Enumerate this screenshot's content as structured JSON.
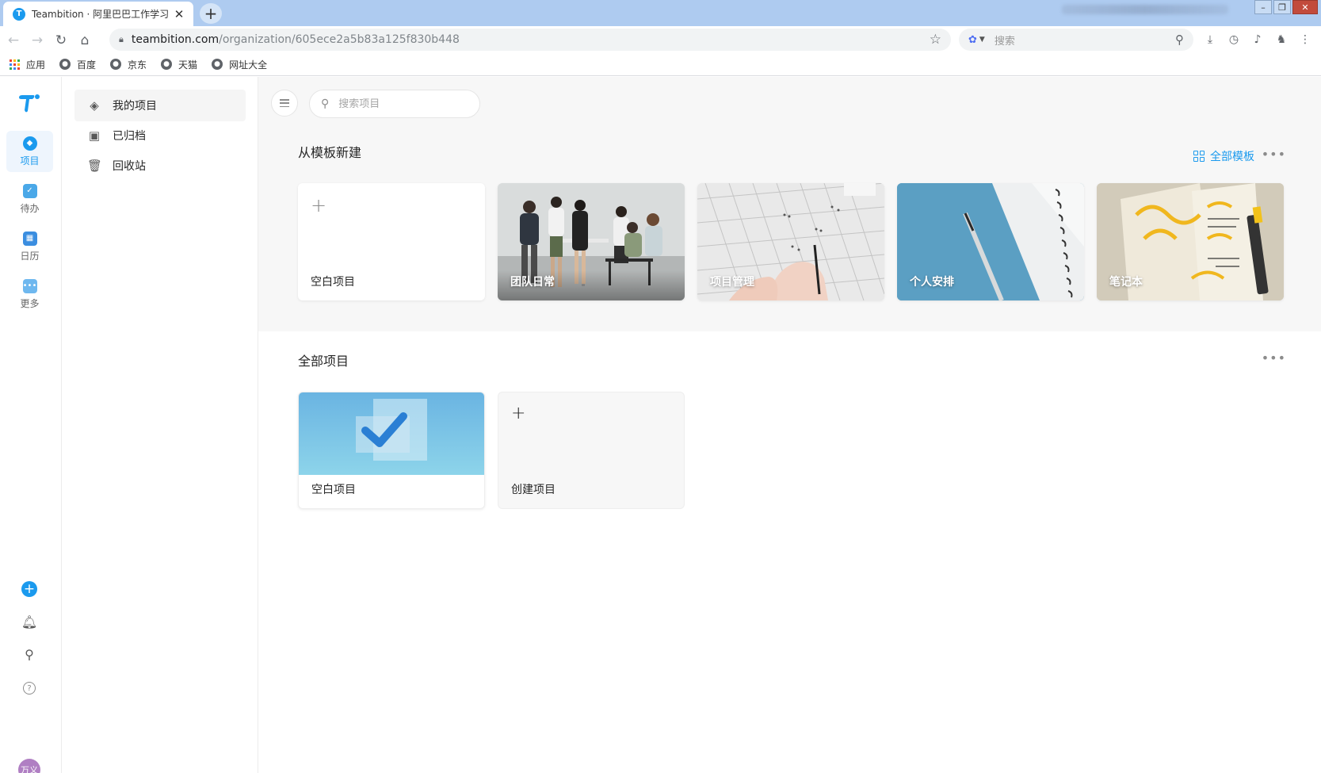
{
  "browser": {
    "tab_title": "Teambition · 阿里巴巴工作学习",
    "tab_favicon": "T",
    "url_host": "teambition.com",
    "url_path": "/organization/605ece2a5b83a125f830b448",
    "search_placeholder": "搜索",
    "bookmarks": [
      "应用",
      "百度",
      "京东",
      "天猫",
      "网址大全"
    ]
  },
  "rail": {
    "items": [
      {
        "label": "项目",
        "icon": "project-cube-icon",
        "color": "#1b9aee"
      },
      {
        "label": "待办",
        "icon": "todo-clipboard-icon",
        "color": "#4aa8e8"
      },
      {
        "label": "日历",
        "icon": "calendar-icon",
        "color": "#3b8ee0"
      },
      {
        "label": "更多",
        "icon": "more-apps-icon",
        "color": "#6fb8ef"
      }
    ],
    "avatar_text": "万义"
  },
  "nav": {
    "items": [
      {
        "label": "我的项目",
        "icon": "layers-icon"
      },
      {
        "label": "已归档",
        "icon": "archive-box-icon"
      },
      {
        "label": "回收站",
        "icon": "trash-icon"
      }
    ]
  },
  "main": {
    "search_placeholder": "搜索项目",
    "templates_title": "从模板新建",
    "all_templates_label": "全部模板",
    "templates": [
      {
        "label": "空白项目"
      },
      {
        "label": "团队日常"
      },
      {
        "label": "项目管理"
      },
      {
        "label": "个人安排"
      },
      {
        "label": "笔记本"
      }
    ],
    "projects_title": "全部项目",
    "projects": [
      {
        "label": "空白项目"
      },
      {
        "label": "创建项目"
      }
    ]
  },
  "colors": {
    "accent": "#1b9aee",
    "tabstrip": "#aecbf0"
  }
}
